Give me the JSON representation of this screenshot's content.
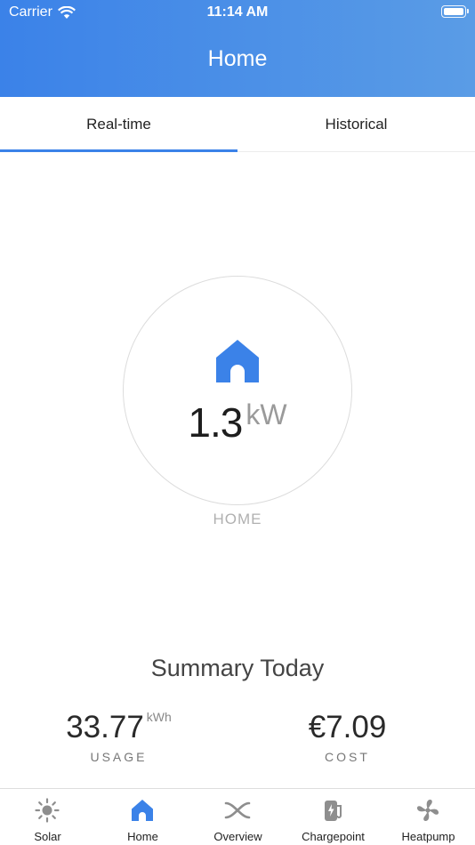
{
  "status_bar": {
    "carrier": "Carrier",
    "time": "11:14 AM"
  },
  "header": {
    "title": "Home"
  },
  "tabs": [
    {
      "label": "Real-time",
      "selected": true
    },
    {
      "label": "Historical",
      "selected": false
    }
  ],
  "realtime": {
    "power_value": "1.3",
    "power_unit": "kW",
    "label": "HOME",
    "icon": "house-icon"
  },
  "summary": {
    "title": "Summary Today",
    "usage": {
      "value": "33.77",
      "unit": "kWh",
      "label": "USAGE"
    },
    "cost": {
      "value": "€7.09",
      "label": "COST"
    }
  },
  "tabbar": {
    "items": [
      {
        "label": "Solar",
        "icon": "sun-icon",
        "active": false
      },
      {
        "label": "Home",
        "icon": "house-icon",
        "active": true
      },
      {
        "label": "Overview",
        "icon": "shuffle-icon",
        "active": false
      },
      {
        "label": "Chargepoint",
        "icon": "charger-icon",
        "active": false
      },
      {
        "label": "Heatpump",
        "icon": "fan-icon",
        "active": false
      }
    ]
  },
  "colors": {
    "accent": "#3b82e8",
    "inactive_icon": "#8e8e8e"
  }
}
